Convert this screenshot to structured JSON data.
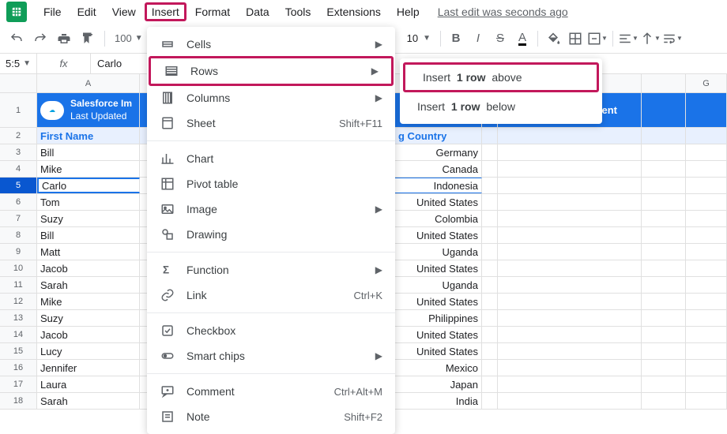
{
  "menubar": [
    "File",
    "Edit",
    "View",
    "Insert",
    "Format",
    "Data",
    "Tools",
    "Extensions",
    "Help"
  ],
  "highlighted_menu_index": 3,
  "last_edit": "Last edit was seconds ago",
  "toolbar": {
    "zoom": "100",
    "font_size": "10"
  },
  "namebox": "5:5",
  "fx_label": "fx",
  "formula_bar": "Carlo",
  "columns": [
    "A",
    "",
    "",
    "",
    "",
    "",
    "G"
  ],
  "row1": {
    "badge": "salesforce",
    "line1": "Salesforce Im",
    "line2": "Last Updated",
    "right": "cient"
  },
  "headers": {
    "A": "First Name",
    "C": "g Country"
  },
  "data_rows": [
    {
      "n": 3,
      "a": "Bill",
      "c": "Germany"
    },
    {
      "n": 4,
      "a": "Mike",
      "c": "Canada"
    },
    {
      "n": 5,
      "a": "Carlo",
      "c": "Indonesia",
      "selected": true
    },
    {
      "n": 6,
      "a": "Tom",
      "c": "United States"
    },
    {
      "n": 7,
      "a": "Suzy",
      "c": "Colombia"
    },
    {
      "n": 8,
      "a": "Bill",
      "c": "United States"
    },
    {
      "n": 9,
      "a": "Matt",
      "c": "Uganda"
    },
    {
      "n": 10,
      "a": "Jacob",
      "c": "United States"
    },
    {
      "n": 11,
      "a": "Sarah",
      "c": "Uganda"
    },
    {
      "n": 12,
      "a": "Mike",
      "c": "United States"
    },
    {
      "n": 13,
      "a": "Suzy",
      "c": "Philippines"
    },
    {
      "n": 14,
      "a": "Jacob",
      "c": "United States"
    },
    {
      "n": 15,
      "a": "Lucy",
      "c": "United States"
    },
    {
      "n": 16,
      "a": "Jennifer",
      "c": "Mexico"
    },
    {
      "n": 17,
      "a": "Laura",
      "c": "Japan"
    },
    {
      "n": 18,
      "a": "Sarah",
      "c": "India"
    }
  ],
  "insert_menu": [
    {
      "icon": "cells",
      "label": "Cells",
      "arrow": true
    },
    {
      "icon": "rows",
      "label": "Rows",
      "arrow": true,
      "highlight": true
    },
    {
      "icon": "columns",
      "label": "Columns",
      "arrow": true
    },
    {
      "icon": "sheet",
      "label": "Sheet",
      "shortcut": "Shift+F11"
    },
    {
      "sep": true
    },
    {
      "icon": "chart",
      "label": "Chart"
    },
    {
      "icon": "pivot",
      "label": "Pivot table"
    },
    {
      "icon": "image",
      "label": "Image",
      "arrow": true
    },
    {
      "icon": "drawing",
      "label": "Drawing"
    },
    {
      "sep": true
    },
    {
      "icon": "function",
      "label": "Function",
      "arrow": true
    },
    {
      "icon": "link",
      "label": "Link",
      "shortcut": "Ctrl+K"
    },
    {
      "sep": true
    },
    {
      "icon": "checkbox",
      "label": "Checkbox"
    },
    {
      "icon": "chips",
      "label": "Smart chips",
      "arrow": true
    },
    {
      "sep": true
    },
    {
      "icon": "comment",
      "label": "Comment",
      "shortcut": "Ctrl+Alt+M"
    },
    {
      "icon": "note",
      "label": "Note",
      "shortcut": "Shift+F2"
    }
  ],
  "submenu": [
    {
      "pre": "Insert",
      "bold": "1 row",
      "post": "above",
      "highlight": true
    },
    {
      "pre": "Insert",
      "bold": "1 row",
      "post": "below"
    }
  ]
}
